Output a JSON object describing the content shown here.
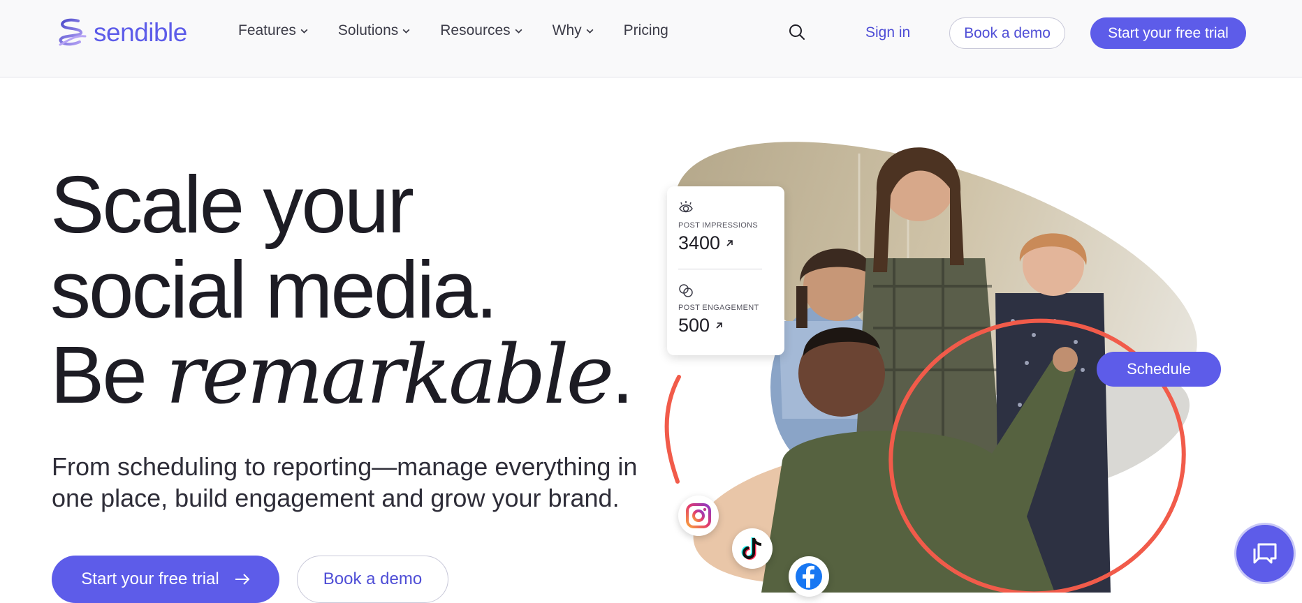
{
  "brand": {
    "name": "sendible",
    "accent": "#5d5ce9",
    "text_dark": "#1d1c24",
    "annotation_red": "#f15b4a"
  },
  "nav": {
    "items": [
      {
        "label": "Features",
        "has_dropdown": true
      },
      {
        "label": "Solutions",
        "has_dropdown": true
      },
      {
        "label": "Resources",
        "has_dropdown": true
      },
      {
        "label": "Why",
        "has_dropdown": true
      },
      {
        "label": "Pricing",
        "has_dropdown": false
      }
    ],
    "search_icon": "search-icon",
    "sign_in": "Sign in",
    "book_demo": "Book a demo",
    "free_trial": "Start your free trial"
  },
  "hero": {
    "headline_line1": "Scale your",
    "headline_line2": "social media.",
    "headline_line3_prefix": "Be ",
    "headline_line3_emphasis": "remarkable",
    "headline_line3_suffix": ".",
    "subtext": "From scheduling to reporting—manage everything in one place, build engagement and grow your brand.",
    "cta_primary": "Start your free trial",
    "cta_secondary": "Book a demo"
  },
  "stats_card": {
    "impressions_label": "POST IMPRESSIONS",
    "impressions_value": "3400",
    "engagement_label": "POST ENGAGEMENT",
    "engagement_value": "500"
  },
  "schedule_label": "Schedule",
  "social_icons": [
    "instagram-icon",
    "tiktok-icon",
    "facebook-icon"
  ],
  "chat_icon": "chat-icon"
}
